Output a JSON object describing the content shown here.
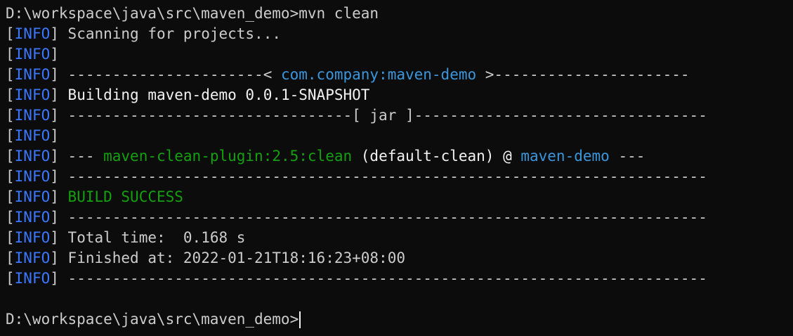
{
  "prompt": {
    "path": "D:\\workspace\\java\\src\\maven_demo>",
    "command": "mvn clean"
  },
  "tag": {
    "open": "[",
    "name": "INFO",
    "close": "]"
  },
  "output": {
    "l1": "Scanning for projects...",
    "l3_left": "----------------------< ",
    "l3_project": "com.company:maven-demo",
    "l3_right": " >----------------------",
    "l4": "Building maven-demo 0.0.1-SNAPSHOT",
    "l5": "--------------------------------[ jar ]---------------------------------",
    "l7_a": "--- ",
    "l7_plugin": "maven-clean-plugin:2.5:clean",
    "l7_b": " (default-clean) @ ",
    "l7_project": "maven-demo",
    "l7_c": " ---",
    "sep": "------------------------------------------------------------------------",
    "build_success": "BUILD SUCCESS",
    "total_time": "Total time:  0.168 s",
    "finished_at": "Finished at: 2022-01-21T18:16:23+08:00"
  },
  "colors": {
    "background": "#0c0c0c",
    "text": "#cccccc",
    "info": "#3b78ff",
    "project": "#3a96dd",
    "success": "#13a10e"
  }
}
